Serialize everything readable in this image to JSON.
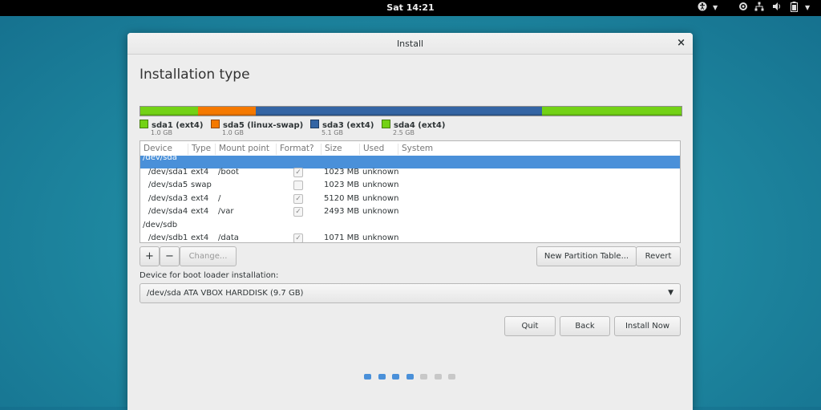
{
  "topbar": {
    "clock": "Sat 14:21"
  },
  "window": {
    "title": "Install"
  },
  "page": {
    "title": "Installation type"
  },
  "partition_bar": [
    {
      "name": "sda1 (ext4)",
      "size": "1.0 GB",
      "color": "#73d216",
      "fraction": 0.107
    },
    {
      "name": "sda5 (linux-swap)",
      "size": "1.0 GB",
      "color": "#f57900",
      "fraction": 0.107
    },
    {
      "name": "sda3 (ext4)",
      "size": "5.1 GB",
      "color": "#3465a4",
      "fraction": 0.528
    },
    {
      "name": "sda4 (ext4)",
      "size": "2.5 GB",
      "color": "#73d216",
      "fraction": 0.258
    }
  ],
  "table": {
    "headers": {
      "device": "Device",
      "type": "Type",
      "mount": "Mount point",
      "format": "Format?",
      "size": "Size",
      "used": "Used",
      "system": "System"
    },
    "rows": [
      {
        "device": "/dev/sda",
        "type": "",
        "mount": "",
        "format": null,
        "size": "",
        "used": "",
        "selected": true,
        "group": true
      },
      {
        "device": "/dev/sda1",
        "type": "ext4",
        "mount": "/boot",
        "format": true,
        "size": "1023 MB",
        "used": "unknown"
      },
      {
        "device": "/dev/sda5",
        "type": "swap",
        "mount": "",
        "format": false,
        "size": "1023 MB",
        "used": "unknown"
      },
      {
        "device": "/dev/sda3",
        "type": "ext4",
        "mount": "/",
        "format": true,
        "size": "5120 MB",
        "used": "unknown"
      },
      {
        "device": "/dev/sda4",
        "type": "ext4",
        "mount": "/var",
        "format": true,
        "size": "2493 MB",
        "used": "unknown"
      },
      {
        "device": "/dev/sdb",
        "type": "",
        "mount": "",
        "format": null,
        "size": "",
        "used": "",
        "group": true
      },
      {
        "device": "/dev/sdb1",
        "type": "ext4",
        "mount": "/data",
        "format": true,
        "size": "1071 MB",
        "used": "unknown"
      }
    ]
  },
  "toolbar": {
    "add": "+",
    "remove": "−",
    "change": "Change...",
    "new_table": "New Partition Table...",
    "revert": "Revert"
  },
  "bootloader": {
    "label": "Device for boot loader installation:",
    "value": "/dev/sda   ATA VBOX HARDDISK (9.7 GB)"
  },
  "actions": {
    "quit": "Quit",
    "back": "Back",
    "install": "Install Now"
  },
  "progress": {
    "total_steps": 7,
    "completed_steps": 4,
    "active_color": "#4a90d9",
    "inactive_color": "#c8c8c8"
  },
  "icons": {
    "accessibility": "accessibility-icon",
    "network": "network-icon",
    "battery": "battery-icon",
    "close": "close-icon"
  }
}
